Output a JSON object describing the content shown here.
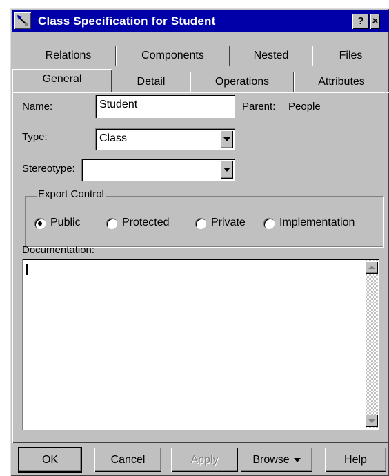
{
  "window": {
    "title": "Class Specification for Student",
    "help_button": "?",
    "close_button": "×"
  },
  "tabs": {
    "back_row": [
      "Relations",
      "Components",
      "Nested",
      "Files"
    ],
    "front_row": [
      "General",
      "Detail",
      "Operations",
      "Attributes"
    ],
    "active": "General"
  },
  "general": {
    "name_label": "Name:",
    "name_value": "Student",
    "parent_label": "Parent:",
    "parent_value": "People",
    "type_label": "Type:",
    "type_value": "Class",
    "stereotype_label": "Stereotype:",
    "stereotype_value": ""
  },
  "export_control": {
    "title": "Export Control",
    "options": [
      "Public",
      "Protected",
      "Private",
      "Implementation"
    ],
    "selected": "Public"
  },
  "documentation": {
    "label": "Documentation:",
    "value": ""
  },
  "buttons": {
    "ok": "OK",
    "cancel": "Cancel",
    "apply": "Apply",
    "browse": "Browse",
    "help": "Help"
  }
}
